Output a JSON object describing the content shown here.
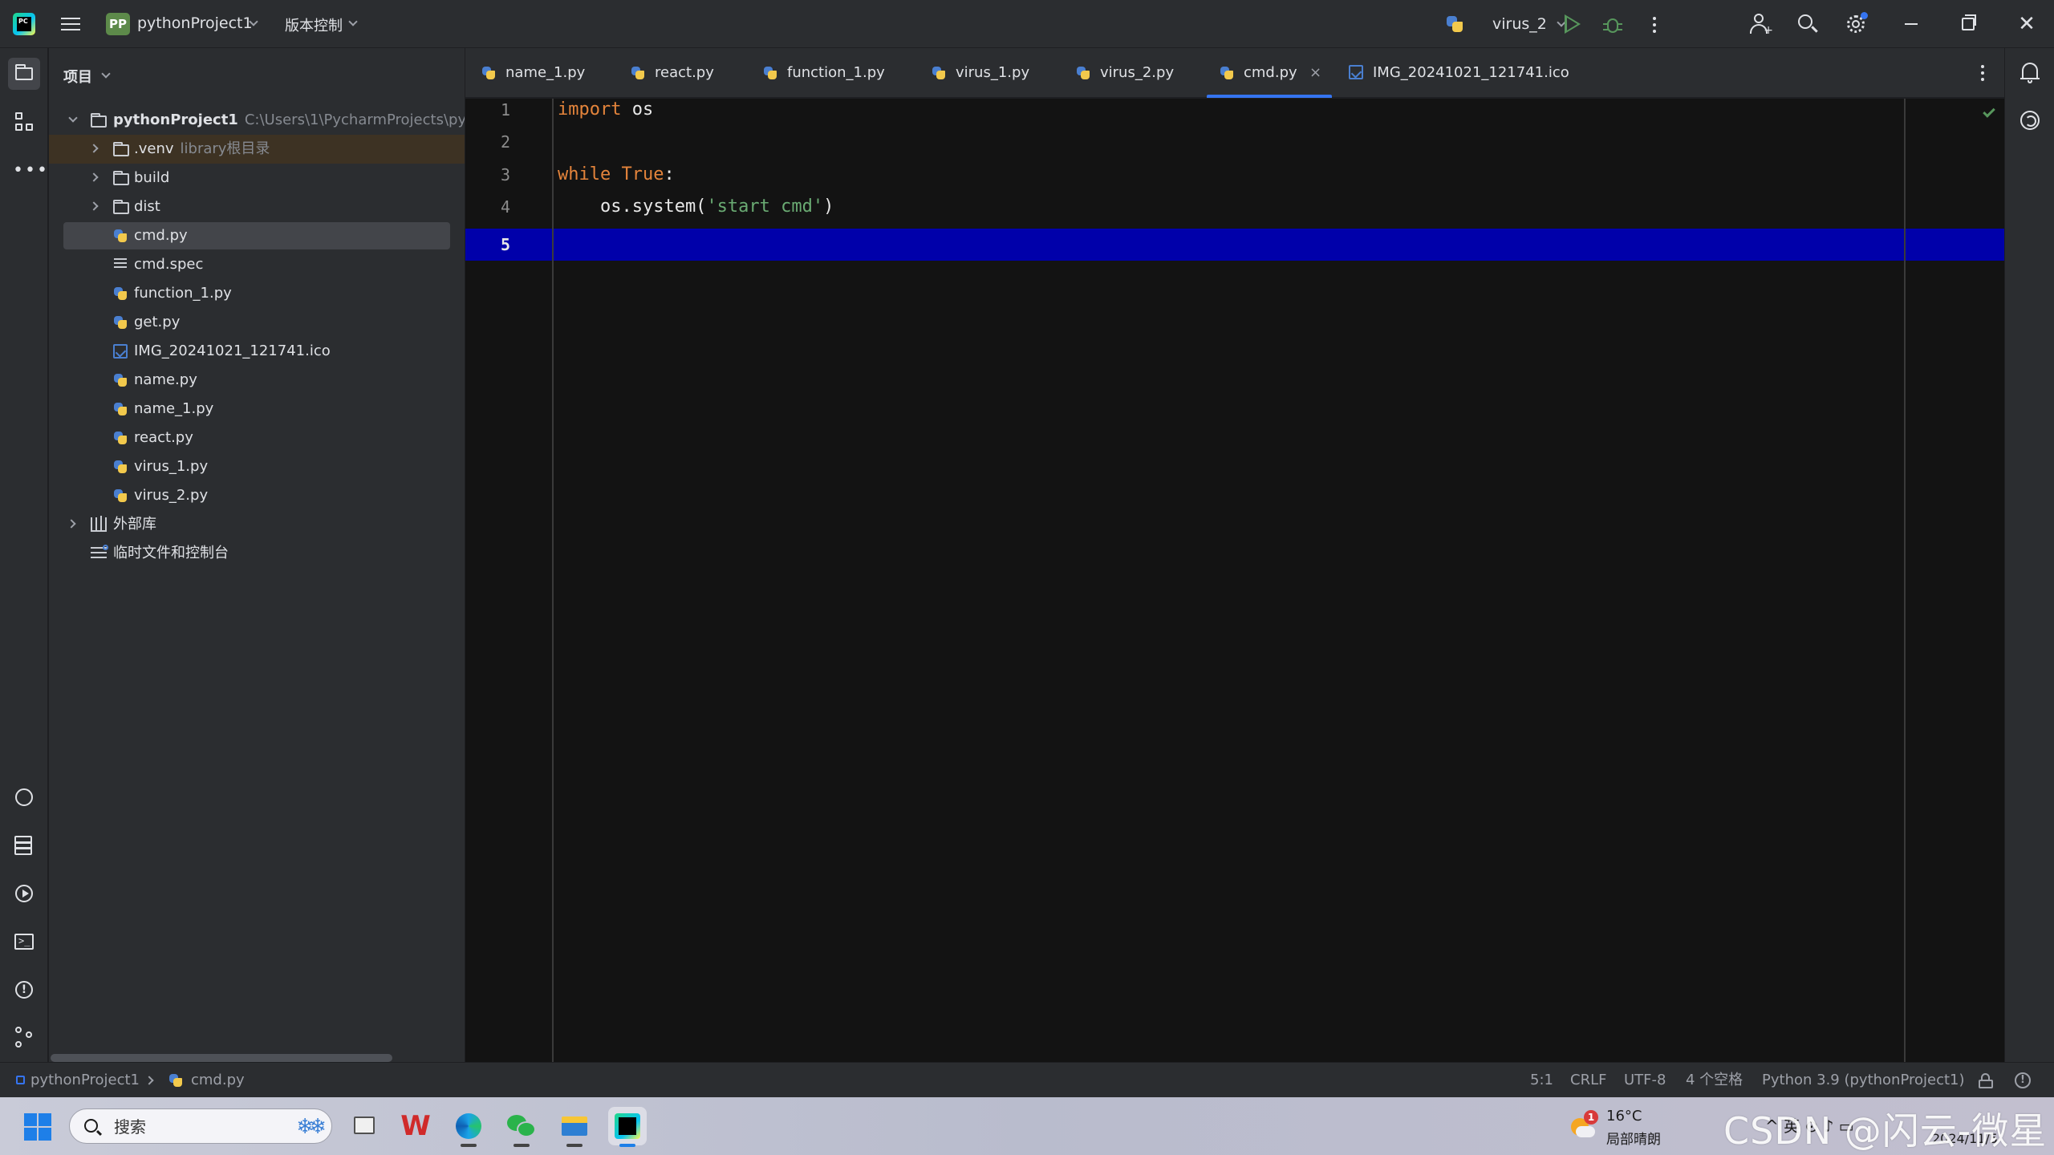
{
  "titlebar": {
    "project_badge": "PP",
    "project_name": "pythonProject1",
    "vcs_label": "版本控制",
    "run_config": "virus_2"
  },
  "project_panel": {
    "header": "项目",
    "root": {
      "name": "pythonProject1",
      "path": "C:\\Users\\1\\PycharmProjects\\pythonProject1"
    },
    "items": [
      {
        "name": ".venv",
        "tag": "library根目录",
        "kind": "folder"
      },
      {
        "name": "build",
        "kind": "folder"
      },
      {
        "name": "dist",
        "kind": "folder"
      },
      {
        "name": "cmd.py",
        "kind": "python",
        "selected": true
      },
      {
        "name": "cmd.spec",
        "kind": "spec"
      },
      {
        "name": "function_1.py",
        "kind": "python"
      },
      {
        "name": "get.py",
        "kind": "python"
      },
      {
        "name": "IMG_20241021_121741.ico",
        "kind": "image"
      },
      {
        "name": "name.py",
        "kind": "python"
      },
      {
        "name": "name_1.py",
        "kind": "python"
      },
      {
        "name": "react.py",
        "kind": "python"
      },
      {
        "name": "virus_1.py",
        "kind": "python"
      },
      {
        "name": "virus_2.py",
        "kind": "python"
      }
    ],
    "external_libs": "外部库",
    "scratches": "临时文件和控制台"
  },
  "tabs": [
    {
      "label": "name_1.py"
    },
    {
      "label": "react.py"
    },
    {
      "label": "function_1.py"
    },
    {
      "label": "virus_1.py"
    },
    {
      "label": "virus_2.py"
    },
    {
      "label": "cmd.py",
      "active": true,
      "close": "×"
    },
    {
      "label": "IMG_20241021_121741.ico"
    }
  ],
  "editor": {
    "line_numbers": [
      "1",
      "2",
      "3",
      "4",
      "5"
    ],
    "current_line": 5,
    "code": {
      "l1_kw": "import",
      "l1_rest": " os",
      "l3_kw1": "while",
      "l3_kw2": "True",
      "l3_sp": " ",
      "l3_colon": ":",
      "l4_pre": "    os.system(",
      "l4_str": "'start cmd'",
      "l4_post": ")"
    }
  },
  "statusbar": {
    "breadcrumb_project": "pythonProject1",
    "breadcrumb_file": "cmd.py",
    "position": "5:1",
    "line_sep": "CRLF",
    "encoding": "UTF-8",
    "indent": "4 个空格",
    "interpreter": "Python 3.9 (pythonProject1)",
    "info": "!"
  },
  "taskbar": {
    "search_placeholder": "搜索",
    "search_deco": "❄❄",
    "wps": "W",
    "weather_badge": "1",
    "weather_temp": "16°C",
    "weather_desc": "局部晴朗",
    "tray_text": "^  英  ⊙  ♪  ▭",
    "date_text": "2024/11/5",
    "watermark": "CSDN @闪云-微星"
  },
  "colors": {
    "accent": "#3574f0",
    "keyword": "#e4843b",
    "string": "#6aab73",
    "current_line": "#0000aa",
    "run_green": "#57965c"
  }
}
